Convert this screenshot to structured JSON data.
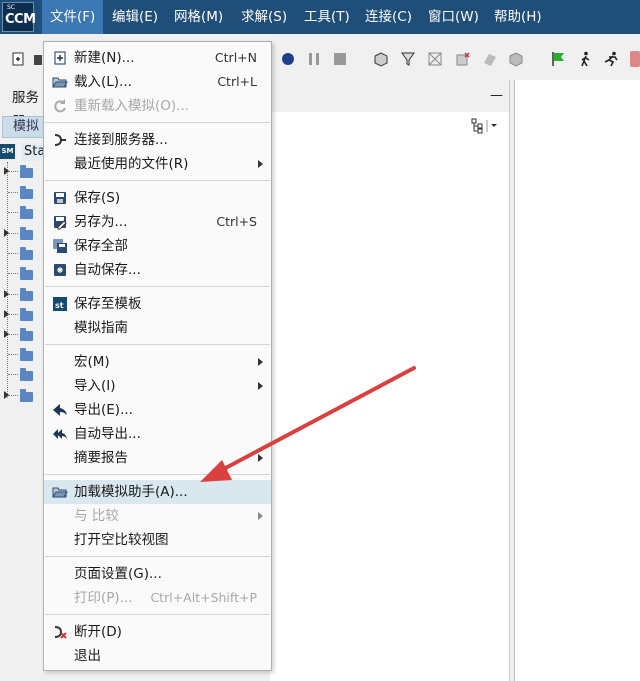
{
  "menubar": {
    "logo_sc": "SC",
    "logo_ccm": "CCM",
    "items": [
      "文件(F)",
      "编辑(E)",
      "网格(M)",
      "求解(S)",
      "工具(T)",
      "连接(C)",
      "窗口(W)",
      "帮助(H)"
    ]
  },
  "left_panel": {
    "tab_label": "服务器",
    "sim_tab": "模拟",
    "root_badge": "SM",
    "root_label": "Sta"
  },
  "file_menu": {
    "items": [
      {
        "label": "新建(N)...",
        "shortcut": "Ctrl+N",
        "icon": "new-document-icon"
      },
      {
        "label": "载入(L)...",
        "shortcut": "Ctrl+L",
        "icon": "open-folder-icon"
      },
      {
        "label": "重新载入模拟(O)...",
        "shortcut": "",
        "icon": "reload-icon",
        "disabled": true
      },
      {
        "label": "连接到服务器...",
        "shortcut": "",
        "icon": "connect-server-icon"
      },
      {
        "label": "最近使用的文件(R)",
        "shortcut": "",
        "submenu": true
      },
      {
        "label": "保存(S)",
        "shortcut": "",
        "icon": "save-icon"
      },
      {
        "label": "另存为...",
        "shortcut": "Ctrl+S",
        "icon": "save-as-icon"
      },
      {
        "label": "保存全部",
        "shortcut": "",
        "icon": "save-all-icon"
      },
      {
        "label": "自动保存...",
        "shortcut": "",
        "icon": "auto-save-icon"
      },
      {
        "label": "保存至模板",
        "shortcut": "",
        "icon": "template-icon"
      },
      {
        "label": "模拟指南",
        "shortcut": ""
      },
      {
        "label": "宏(M)",
        "submenu": true
      },
      {
        "label": "导入(I)",
        "submenu": true
      },
      {
        "label": "导出(E)...",
        "icon": "export-icon"
      },
      {
        "label": "自动导出...",
        "icon": "auto-export-icon"
      },
      {
        "label": "摘要报告",
        "submenu": true
      },
      {
        "label": "加载模拟助手(A)...",
        "icon": "open-folder-icon",
        "highlight": true
      },
      {
        "label": "与 比较",
        "submenu": true,
        "disabled": true
      },
      {
        "label": "打开空比较视图"
      },
      {
        "label": "页面设置(G)..."
      },
      {
        "label": "打印(P)...",
        "shortcut": "Ctrl+Alt+Shift+P",
        "disabled": true
      },
      {
        "label": "断开(D)",
        "icon": "disconnect-icon"
      },
      {
        "label": "退出"
      }
    ]
  },
  "colors": {
    "menubar_bg": "#1f4e79",
    "menu_active": "#3c78b4",
    "highlight": "#d9e8ef",
    "annotation_arrow": "#d9403f"
  }
}
